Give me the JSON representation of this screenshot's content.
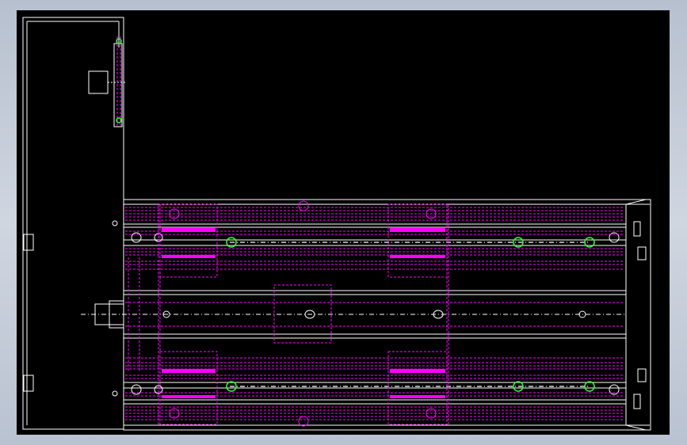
{
  "drawing": {
    "background": "#000000",
    "frame_color": "#b9c2d1",
    "colors": {
      "outline": "#ffffff",
      "hidden": "#ff00ff",
      "bolt": "#33ff33"
    }
  }
}
